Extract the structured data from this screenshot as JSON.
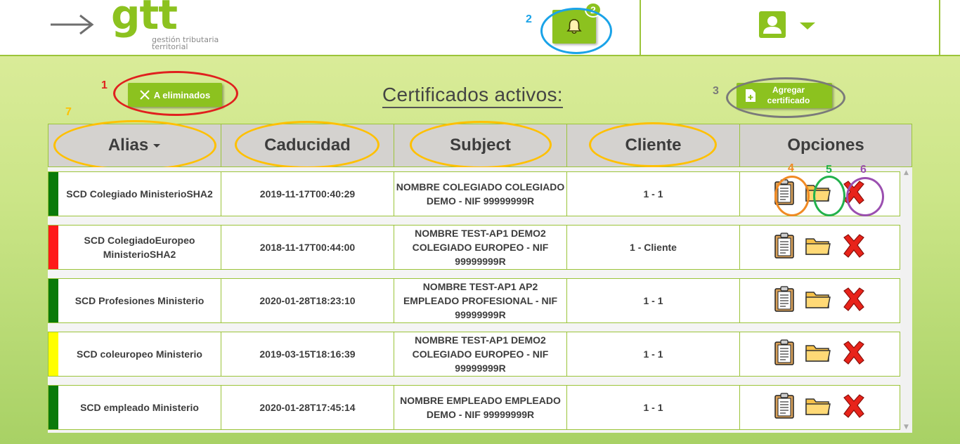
{
  "header": {
    "logo_name": "gtt",
    "logo_line1": "gestión tributaria",
    "logo_line2": "territorial",
    "notification_count": "2"
  },
  "annotations": {
    "n1": "1",
    "n2": "2",
    "n3": "3",
    "n4": "4",
    "n5": "5",
    "n6": "6",
    "n7": "7",
    "colors": {
      "red": "#e0201e",
      "blue": "#1aa3e8",
      "gray": "#7a7a7a",
      "orange": "#f08a24",
      "green": "#22b14c",
      "purple": "#9b4fb0",
      "yellow": "#ffc000"
    }
  },
  "toolbar": {
    "eliminados_label": "A eliminados",
    "add_line1": "Agregar",
    "add_line2": "certificado"
  },
  "page_title": "Certificados activos:",
  "table": {
    "headers": [
      "Alias",
      "Caducidad",
      "Subject",
      "Cliente",
      "Opciones"
    ],
    "rows": [
      {
        "status_color": "#0a7a0a",
        "alias": "SCD Colegiado MinisterioSHA2",
        "caducidad": "2019-11-17T00:40:29",
        "subject": "NOMBRE COLEGIADO COLEGIADO DEMO - NIF 99999999R",
        "cliente": "1 - 1"
      },
      {
        "status_color": "#ff1a1a",
        "alias": "SCD ColegiadoEuropeo MinisterioSHA2",
        "caducidad": "2018-11-17T00:44:00",
        "subject": "NOMBRE TEST-AP1 DEMO2 COLEGIADO EUROPEO - NIF 99999999R",
        "cliente": "1 - Cliente"
      },
      {
        "status_color": "#0a7a0a",
        "alias": "SCD Profesiones Ministerio",
        "caducidad": "2020-01-28T18:23:10",
        "subject": "NOMBRE TEST-AP1 AP2 EMPLEADO PROFESIONAL - NIF 99999999R",
        "cliente": "1 - 1"
      },
      {
        "status_color": "#ffff00",
        "alias": "SCD coleuropeo Ministerio",
        "caducidad": "2019-03-15T18:16:39",
        "subject": "NOMBRE TEST-AP1 DEMO2 COLEGIADO EUROPEO - NIF 99999999R",
        "cliente": "1 - 1"
      },
      {
        "status_color": "#0a7a0a",
        "alias": "SCD empleado Ministerio",
        "caducidad": "2020-01-28T17:45:14",
        "subject": "NOMBRE EMPLEADO EMPLEADO DEMO - NIF 99999999R",
        "cliente": "1 - 1"
      }
    ]
  }
}
